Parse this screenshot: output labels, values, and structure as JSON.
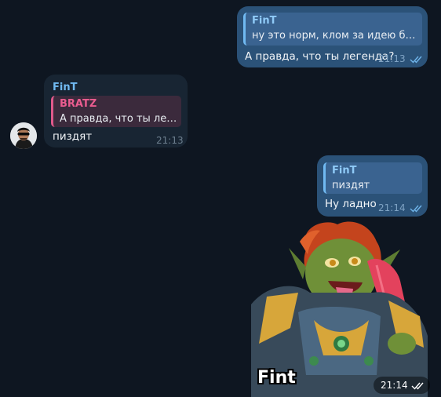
{
  "colors": {
    "background": "#0e1621",
    "outgoing_bubble": "#2b5278",
    "incoming_bubble": "#182533",
    "accent_blue": "#71baf2",
    "accent_pink": "#ea5c8f"
  },
  "messages": [
    {
      "direction": "outgoing",
      "reply": {
        "name": "FinT",
        "text": "ну это норм, клом за идею быт..."
      },
      "text": "А правда, что ты легенда?",
      "time": "21:13",
      "status_icon": "double-check-icon"
    },
    {
      "direction": "incoming",
      "sender": "FinT",
      "reply": {
        "name": "BRATZ",
        "text": "А правда, что ты леге..."
      },
      "text": "пиздят",
      "time": "21:13",
      "avatar": "avatar-sunglasses"
    },
    {
      "direction": "outgoing",
      "reply": {
        "name": "FinT",
        "text": "пиздят"
      },
      "text": "Ну ладно",
      "time": "21:14",
      "status_icon": "double-check-icon"
    },
    {
      "direction": "outgoing",
      "type": "sticker",
      "sticker_label": "Fint",
      "sticker_description": "goblin-sticker",
      "time": "21:14",
      "status_icon": "double-check-icon"
    }
  ]
}
